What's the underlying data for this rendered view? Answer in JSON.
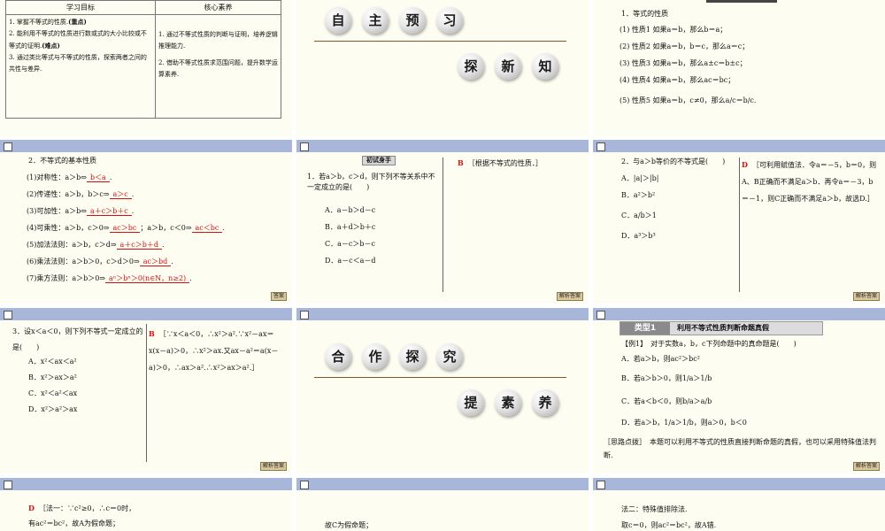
{
  "slide1": {
    "col_goal": "学习目标",
    "col_core": "核心素养",
    "goals": [
      {
        "text": "1. 掌握不等式的性质.",
        "tag": "(重点)"
      },
      {
        "text": "2. 能利用不等式的性质进行数或式的大小比较或不等式的证明.",
        "tag": "(难点)"
      },
      {
        "text": "3. 通过类比等式与不等式的性质，探索两者之间的共性与差异.",
        "tag": ""
      }
    ],
    "cores": [
      "1. 通过不等式性质的判断与证明，培养逻辑推理能力.",
      "2. 借助不等式性质求范围问题，提升数学运算素养."
    ]
  },
  "slide2": {
    "balls_top": [
      "自",
      "主",
      "预",
      "习"
    ],
    "balls_bottom": [
      "探",
      "新",
      "知"
    ]
  },
  "slide3": {
    "heading": "1．等式的性质",
    "items": [
      "(1) 性质1 如果a＝b，那么b＝a；",
      "(2) 性质2 如果a＝b，b＝c，那么a＝c；",
      "(3) 性质3 如果a＝b，那么a±c＝b±c；",
      "(4) 性质4 如果a＝b，那么ac＝bc；",
      "(5) 性质5 如果a＝b，c≠0，那么a/c＝b/c."
    ]
  },
  "slide4": {
    "heading": "2．不等式的基本性质",
    "rows": [
      {
        "pre": "(1)对称性：a＞b⇔",
        "ans": "b＜a",
        "post": "."
      },
      {
        "pre": "(2)传递性：a＞b，b＞c⇒",
        "ans": "a＞c",
        "post": "."
      },
      {
        "pre": "(3)可加性：a＞b⇔",
        "ans": "a＋c＞b＋c",
        "post": "."
      },
      {
        "pre": "(4)可乘性：a＞b，c＞0⇒",
        "ans": "ac＞bc",
        "mid": "；a＞b，c＜0⇒",
        "ans2": "ac＜bc",
        "post": "."
      },
      {
        "pre": "(5)加法法则：a＞b，c＞d⇒",
        "ans": "a＋c＞b＋d",
        "post": "."
      },
      {
        "pre": "(6)乘法法则：a＞b＞0，c＞d＞0⇒",
        "ans": "ac＞bd",
        "post": "."
      },
      {
        "pre": "(7)乘方法则：a＞b＞0⇒",
        "ans": "aⁿ＞bⁿ＞0(n∈N，n≥2)",
        "post": "."
      }
    ],
    "btn": "答案"
  },
  "slide5": {
    "tag": "初试身手",
    "question": "1．若a＞b，c＞d，则下列不等关系中不一定成立的是(　　)",
    "options": [
      "A．a－b＞d－c",
      "B．a＋d＞b＋c",
      "C．a－c＞b－c",
      "D．a－c＜a－d"
    ],
    "answer_letter": "B",
    "answer_text": "［根据不等式的性质．］",
    "btn": "解析答案"
  },
  "slide6": {
    "question": "2．与a＞b等价的不等式是(　　)",
    "options": [
      "A．|a|＞|b|",
      "B．a²＞b²",
      "C．a/b＞1",
      "D．a³＞b³"
    ],
    "answer_letter": "D",
    "answer_text": "［可利用赋值法．令a＝－5，b＝0，则A、B正确而不满足a＞b．再令a＝－3，b＝－1，则C正确而不满足a＞b，故选D.］",
    "btn": "解析答案"
  },
  "slide7": {
    "question": "3．设x＜a＜0，则下列不等式一定成立的是(　　)",
    "options": [
      "A．x²＜ax＜a²",
      "B．x²＞ax＞a²",
      "C．x²＜a²＜ax",
      "D．x²＞a²＞ax"
    ],
    "answer_letter": "B",
    "answer_text": "［∵x＜a＜0，∴x²＞a².∵x²－ax＝x(x－a)＞0，∴x²＞ax.又ax－a²＝a(x－a)＞0，∴ax＞a².∴x²＞ax＞a².］",
    "btn": "解析答案"
  },
  "slide8": {
    "balls_top": [
      "合",
      "作",
      "探",
      "究"
    ],
    "balls_bottom": [
      "提",
      "素",
      "养"
    ]
  },
  "slide9": {
    "type_label": "类型1",
    "type_title": "利用不等式性质判断命题真假",
    "example": "【例1】　对于实数a，b，c下列命题中的真命题是(　　)",
    "options": [
      "A．若a＞b，则ac²＞bc²",
      "B．若a＞b＞0，则1/a＞1/b",
      "C．若a＜b＜0，则b/a＞a/b",
      "D．若a＞b，1/a＞1/b，则a＞0，b＜0"
    ],
    "hint": "［思路点拨］　本题可以利用不等式的性质直接判断命题的真假，也可以采用特殊值法判断.",
    "btn": "解析答案"
  },
  "slide10": {
    "answer_letter": "D",
    "lines": [
      "［法一：∵c²≥0，∴c＝0时，",
      "有ac²＝bc²，故A为假命题；"
    ]
  },
  "slide11": {
    "lines": [
      "故C为假命题；"
    ]
  },
  "slide12": {
    "lines": [
      "法二：特殊值排除法.",
      "取c＝0，则ac²＝bc²，故A错."
    ]
  }
}
